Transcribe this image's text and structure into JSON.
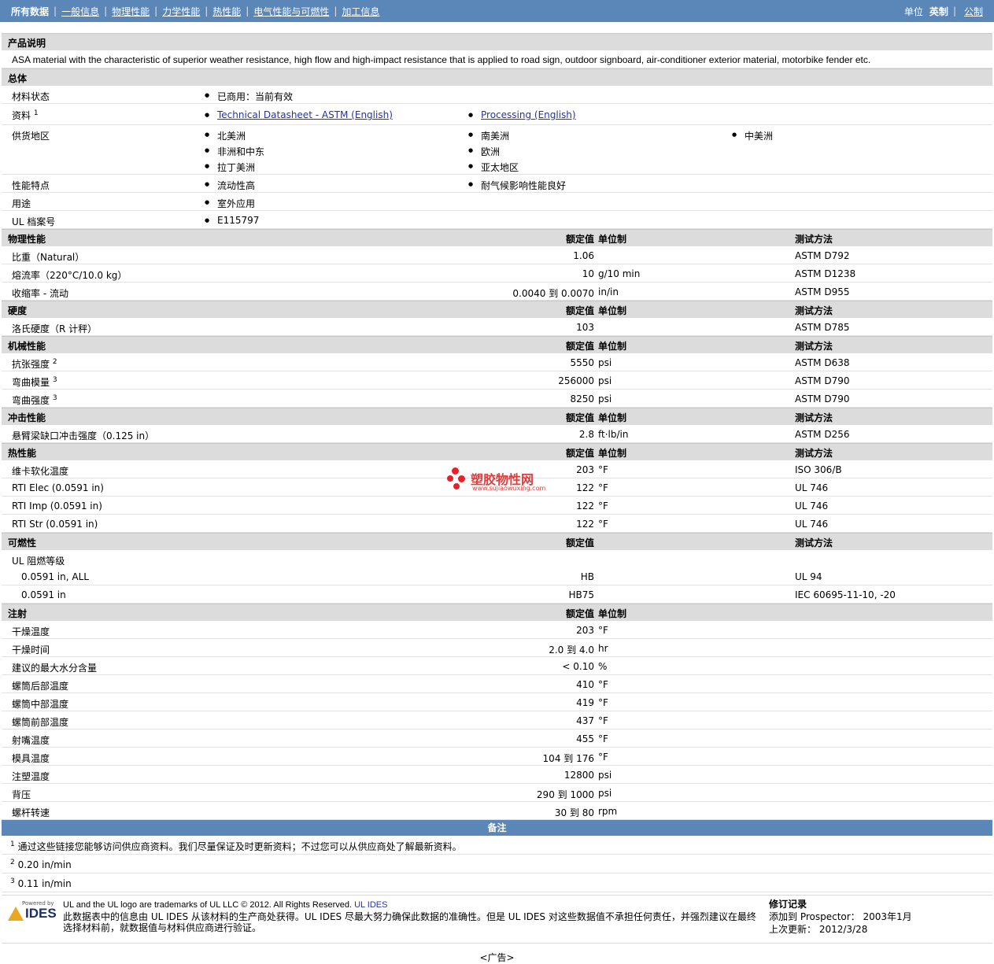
{
  "nav": {
    "tabs": [
      "所有数据",
      "一般信息",
      "物理性能",
      "力学性能",
      "热性能",
      "电气性能与可燃性",
      "加工信息"
    ],
    "units_label": "单位",
    "unit_active": "英制",
    "unit_other": "公制"
  },
  "product": {
    "header": "产品说明",
    "description": "ASA material with the characteristic of superior weather resistance, high flow and high-impact resistance that is applied to road sign, outdoor signboard, air-conditioner exterior material, motorbike fender etc."
  },
  "general": {
    "header": "总体",
    "status_label": "材料状态",
    "status_value": "已商用：当前有效",
    "docs_label": "资料",
    "docs_sup": "1",
    "doc1": "Technical Datasheet - ASTM (English)",
    "doc2": "Processing (English)",
    "regions_label": "供货地区",
    "regions": [
      "北美洲",
      "南美洲",
      "中美洲",
      "非洲和中东",
      "欧洲",
      "拉丁美洲",
      "亚太地区"
    ],
    "features_label": "性能特点",
    "features": [
      "流动性高",
      "耐气候影响性能良好"
    ],
    "uses_label": "用途",
    "uses": [
      "室外应用"
    ],
    "ul_label": "UL 档案号",
    "ul_value": "E115797"
  },
  "col": {
    "value": "额定值",
    "unit": "单位制",
    "method": "测试方法"
  },
  "physical": {
    "header": "物理性能",
    "rows": [
      {
        "label": "比重（Natural）",
        "value": "1.06",
        "unit": "",
        "method": "ASTM D792"
      },
      {
        "label": "熔流率（220°C/10.0 kg）",
        "value": "10",
        "unit": "g/10 min",
        "method": "ASTM D1238"
      },
      {
        "label": "收缩率 - 流动",
        "value": "0.0040 到  0.0070",
        "unit": "in/in",
        "method": "ASTM D955"
      }
    ]
  },
  "hardness": {
    "header": "硬度",
    "rows": [
      {
        "label": "洛氏硬度（R 计秤）",
        "value": "103",
        "unit": "",
        "method": "ASTM D785"
      }
    ]
  },
  "mechanical": {
    "header": "机械性能",
    "rows": [
      {
        "label": "抗张强度",
        "sup": "2",
        "value": "5550",
        "unit": "psi",
        "method": "ASTM D638"
      },
      {
        "label": "弯曲模量",
        "sup": "3",
        "value": "256000",
        "unit": "psi",
        "method": "ASTM D790"
      },
      {
        "label": "弯曲强度",
        "sup": "3",
        "value": "8250",
        "unit": "psi",
        "method": "ASTM D790"
      }
    ]
  },
  "impact": {
    "header": "冲击性能",
    "rows": [
      {
        "label": "悬臂梁缺口冲击强度（0.125 in）",
        "value": "2.8",
        "unit": "ft·lb/in",
        "method": "ASTM D256"
      }
    ]
  },
  "thermal": {
    "header": "热性能",
    "rows": [
      {
        "label": "维卡软化温度",
        "value": "203",
        "unit": "°F",
        "method": "ISO 306/B"
      },
      {
        "label": "RTI Elec (0.0591 in)",
        "value": "122",
        "unit": "°F",
        "method": "UL 746"
      },
      {
        "label": "RTI Imp (0.0591 in)",
        "value": "122",
        "unit": "°F",
        "method": "UL 746"
      },
      {
        "label": "RTI Str (0.0591 in)",
        "value": "122",
        "unit": "°F",
        "method": "UL 746"
      }
    ]
  },
  "flammability": {
    "header": "可燃性",
    "group_label": "UL 阻燃等级",
    "rows": [
      {
        "label": "0.0591 in, ALL",
        "value": "HB",
        "unit": "",
        "method": "UL 94"
      },
      {
        "label": "0.0591 in",
        "value": "HB75",
        "unit": "",
        "method": "IEC 60695-11-10, -20"
      }
    ]
  },
  "injection": {
    "header": "注射",
    "rows": [
      {
        "label": "干燥温度",
        "value": "203",
        "unit": "°F"
      },
      {
        "label": "干燥时间",
        "value": "2.0 到  4.0",
        "unit": "hr"
      },
      {
        "label": "建议的最大水分含量",
        "value": "< 0.10",
        "unit": "%"
      },
      {
        "label": "螺筒后部温度",
        "value": "410",
        "unit": "°F"
      },
      {
        "label": "螺筒中部温度",
        "value": "419",
        "unit": "°F"
      },
      {
        "label": "螺筒前部温度",
        "value": "437",
        "unit": "°F"
      },
      {
        "label": "射嘴温度",
        "value": "455",
        "unit": "°F"
      },
      {
        "label": "模具温度",
        "value": "104 到  176",
        "unit": "°F"
      },
      {
        "label": "注塑温度",
        "value": "12800",
        "unit": "psi"
      },
      {
        "label": "背压",
        "value": "290 到  1000",
        "unit": "psi"
      },
      {
        "label": "螺杆转速",
        "value": "30 到  80",
        "unit": "rpm"
      }
    ]
  },
  "notes": {
    "header": "备注",
    "items": [
      {
        "sup": "1",
        "text": "通过这些链接您能够访问供应商资料。我们尽量保证及时更新资料；不过您可以从供应商处了解最新资料。"
      },
      {
        "sup": "2",
        "text": "0.20 in/min"
      },
      {
        "sup": "3",
        "text": "0.11 in/min"
      }
    ]
  },
  "footer": {
    "powered": "Powered by",
    "logo_text": "IDES",
    "trademark": "UL and the UL logo are trademarks of UL LLC © 2012. All Rights Reserved.",
    "trademark_link": "UL IDES",
    "disclaimer": "此数据表中的信息由  UL IDES 从该材料的生产商处获得。UL IDES 尽最大努力确保此数据的准确性。但是  UL IDES 对这些数据值不承担任何责任，并强烈建议在最终选择材料前，就数据值与材料供应商进行验证。",
    "rev_title": "修订记录",
    "added": "添加到  Prospector：  2003年1月",
    "updated": "上次更新：  2012/3/28"
  },
  "watermark": {
    "name": "塑胶物性网",
    "url": "www.sujiaowuxing.com"
  },
  "ad": "<广告>"
}
